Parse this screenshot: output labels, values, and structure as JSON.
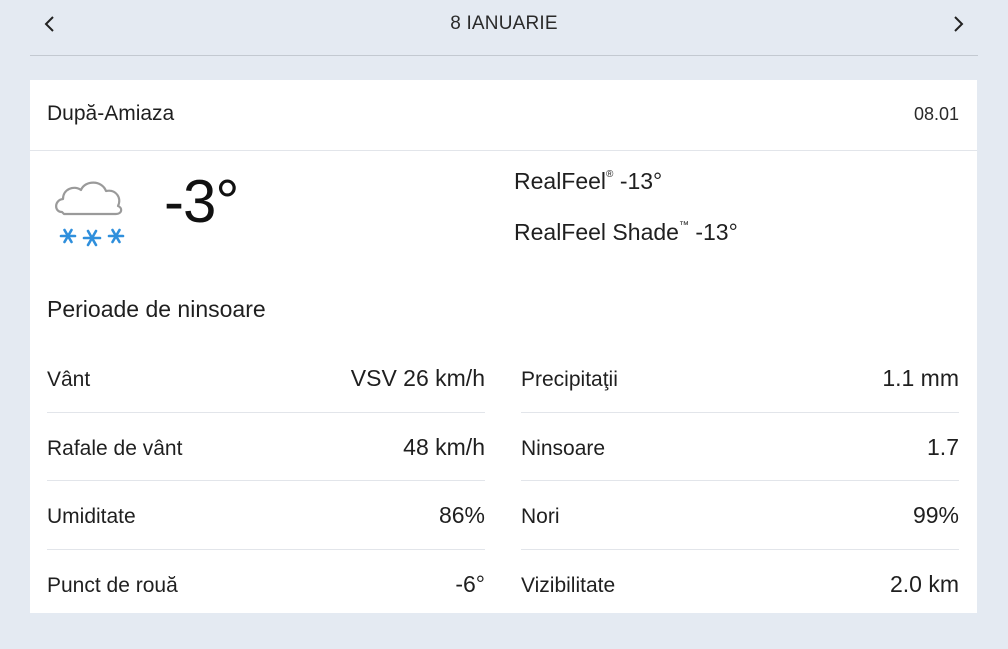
{
  "nav": {
    "title": "8 IANUARIE",
    "prev_icon": "chevron-left-icon",
    "next_icon": "chevron-right-icon"
  },
  "card": {
    "period": "După-Amiaza",
    "date": "08.01",
    "icon": "snow-cloud-icon",
    "temperature": "-3°",
    "realfeel": {
      "label": "RealFeel",
      "mark": "®",
      "value": "-13°"
    },
    "realfeel_shade": {
      "label": "RealFeel Shade",
      "mark": "™",
      "value": "-13°"
    },
    "phrase": "Perioade de ninsoare",
    "left_details": [
      {
        "label": "Vânt",
        "value": "VSV 26 km/h"
      },
      {
        "label": "Rafale de vânt",
        "value": "48 km/h"
      },
      {
        "label": "Umiditate",
        "value": "86%"
      },
      {
        "label": "Punct de rouă",
        "value": "-6°"
      }
    ],
    "right_details": [
      {
        "label": "Precipitaţii",
        "value": "1.1 mm"
      },
      {
        "label": "Ninsoare",
        "value": "1.7"
      },
      {
        "label": "Nori",
        "value": "99%"
      },
      {
        "label": "Vizibilitate",
        "value": "2.0 km"
      }
    ]
  },
  "colors": {
    "background": "#e4eaf2",
    "card": "#ffffff",
    "snowflake": "#2f8fdc",
    "cloud_outline": "#9a9a9a"
  }
}
